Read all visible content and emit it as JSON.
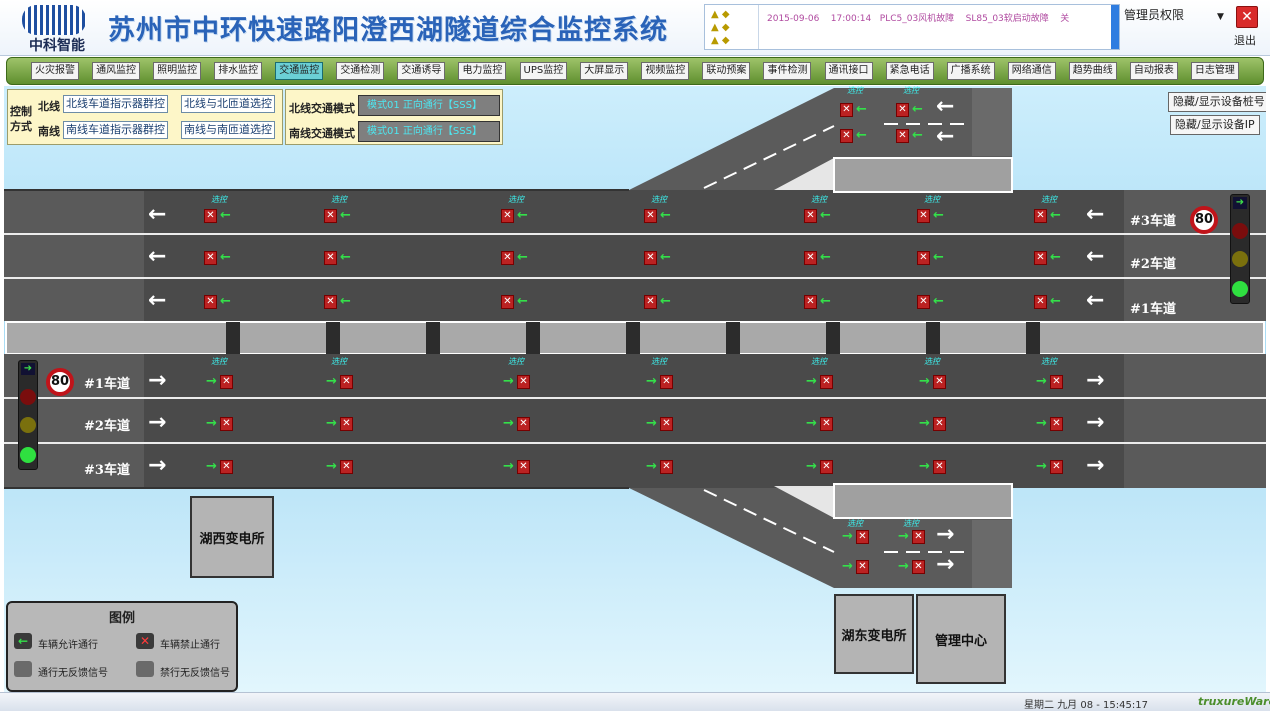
{
  "header": {
    "logo_name": "中科智能",
    "title": "苏州市中环快速路阳澄西湖隧道综合监控系统",
    "alarm": {
      "date": "2015-09-06",
      "time": "17:00:14",
      "message1": "PLC5_03风机故障",
      "message2": "SL85_03软启动故障",
      "message3": "关"
    },
    "admin_label": "管理员权限",
    "admin_caret": "▼",
    "exit_icon": "✕",
    "exit_label": "退出"
  },
  "toolbar": {
    "items": [
      {
        "label": "火灾报警",
        "active": false
      },
      {
        "label": "通风监控",
        "active": false
      },
      {
        "label": "照明监控",
        "active": false
      },
      {
        "label": "排水监控",
        "active": false
      },
      {
        "label": "交通监控",
        "active": true
      },
      {
        "label": "交通检测",
        "active": false
      },
      {
        "label": "交通诱导",
        "active": false
      },
      {
        "label": "电力监控",
        "active": false
      },
      {
        "label": "UPS监控",
        "active": false
      },
      {
        "label": "大屏显示",
        "active": false
      },
      {
        "label": "视频监控",
        "active": false
      },
      {
        "label": "联动预案",
        "active": false
      },
      {
        "label": "事件检测",
        "active": false
      },
      {
        "label": "通讯接口",
        "active": false
      },
      {
        "label": "紧急电话",
        "active": false
      },
      {
        "label": "广播系统",
        "active": false
      },
      {
        "label": "网络通信",
        "active": false
      },
      {
        "label": "趋势曲线",
        "active": false
      },
      {
        "label": "自动报表",
        "active": false
      },
      {
        "label": "日志管理",
        "active": false
      }
    ]
  },
  "control": {
    "method_label": "控制方式",
    "north_label": "北线",
    "south_label": "南线",
    "north_group_btn": "北线车道指示器群控",
    "north_ramp_btn": "北线与北匝道选控",
    "south_group_btn": "南线车道指示器群控",
    "south_ramp_btn": "南线与南匝道选控"
  },
  "traffic_mode": {
    "north_label": "北线交通模式",
    "north_value": "模式01 正向通行【SSS】",
    "south_label": "南线交通模式",
    "south_value": "模式01 正向通行【SSS】"
  },
  "actions": {
    "hide_pile": "隐藏/显示设备桩号",
    "hide_ip": "隐藏/显示设备IP"
  },
  "lanes": {
    "north": [
      "#3车道",
      "#2车道",
      "#1车道"
    ],
    "south": [
      "#1车道",
      "#2车道",
      "#3车道"
    ]
  },
  "speed_limit": "80",
  "signal_caption": "选控",
  "icons": {
    "allow": "←",
    "forbid": "✕",
    "flow_left": "←",
    "flow_right": "→"
  },
  "buildings": {
    "west_substation": "湖西变电所",
    "east_substation": "湖东变电所",
    "management": "管理中心"
  },
  "legend": {
    "title": "图例",
    "allow": "车辆允许通行",
    "forbid": "车辆禁止通行",
    "allow_nofb": "通行无反馈信号",
    "forbid_nofb": "禁行无反馈信号"
  },
  "status": {
    "clock": "星期二 九月 08  - 15:45:17",
    "brand": "truxureWare"
  },
  "colors": {
    "accent": "#2a63b8",
    "toolbar": "#6d9b35",
    "signal_green": "#34e04a",
    "signal_red": "#b22222",
    "caption": "#3cf0ee"
  }
}
